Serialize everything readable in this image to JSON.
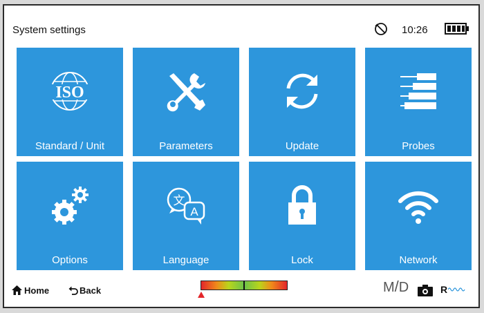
{
  "header": {
    "title": "System settings",
    "time": "10:26",
    "sync_icon": "rotate-sensor-icon",
    "battery_icon": "battery-full-icon"
  },
  "tiles": [
    {
      "label": "Standard / Unit",
      "icon": "iso-globe-icon"
    },
    {
      "label": "Parameters",
      "icon": "tools-icon"
    },
    {
      "label": "Update",
      "icon": "refresh-icon"
    },
    {
      "label": "Probes",
      "icon": "probes-icon"
    },
    {
      "label": "Options",
      "icon": "gears-icon"
    },
    {
      "label": "Language",
      "icon": "language-icon"
    },
    {
      "label": "Lock",
      "icon": "lock-icon"
    },
    {
      "label": "Network",
      "icon": "wifi-icon"
    }
  ],
  "iso_text": "ISO",
  "footer": {
    "home_label": "Home",
    "back_label": "Back",
    "md_m": "M",
    "md_d": "D",
    "r_label": "R"
  },
  "colors": {
    "tile": "#2d96dc",
    "meter_low": "#e3262a",
    "meter_mid": "#6cc24a"
  }
}
